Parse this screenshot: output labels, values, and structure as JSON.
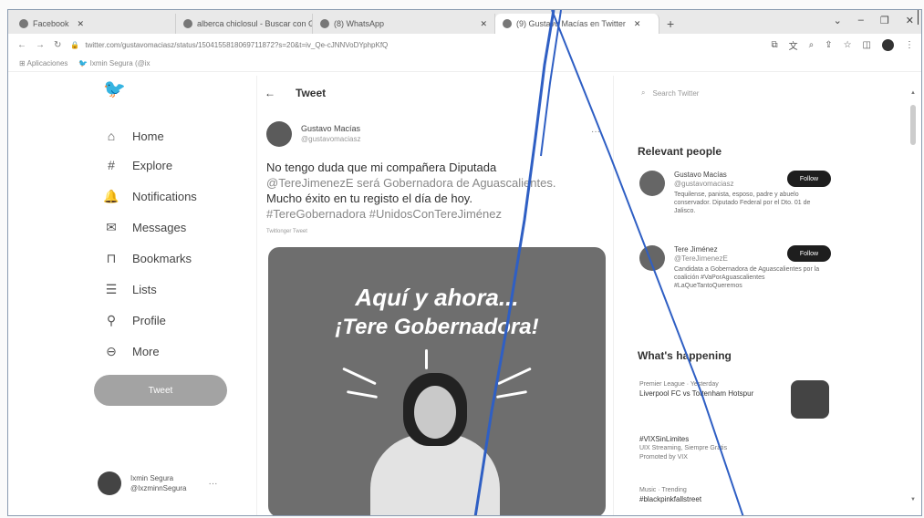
{
  "browser": {
    "tabs": [
      {
        "label": "Facebook",
        "active": false
      },
      {
        "label": "alberca chiclosul - Buscar con G",
        "active": false
      },
      {
        "label": "(8) WhatsApp",
        "active": false
      },
      {
        "label": "(9) Gustavo Macías en Twitter",
        "active": true
      }
    ],
    "url": "twitter.com/gustavomaciasz/status/1504155818069711872?s=20&t=iv_Qe-cJNNVoDYphpKfQ",
    "bookmarks": [
      "Aplicaciones",
      "Ixmin Segura (@ix"
    ]
  },
  "nav": {
    "items": [
      "Home",
      "Explore",
      "Notifications",
      "Messages",
      "Bookmarks",
      "Lists",
      "Profile",
      "More"
    ],
    "tweet_button": "Tweet",
    "account_name": "Ixmin Segura",
    "account_handle": "@IxzminnSegura"
  },
  "main": {
    "header": "Tweet",
    "author_name": "Gustavo Macías",
    "author_handle": "@gustavomaciasz",
    "text_line1": "No tengo duda que mi compañera Diputada",
    "text_line2": "@TereJimenezE será Gobernadora de Aguascalientes.",
    "text_line3": "Mucho éxito en tu registo el día de hoy.",
    "text_line4": "#TereGobernadora #UnidosConTereJiménez",
    "source": "Twitlonger Tweet",
    "image_line1": "Aquí y ahora...",
    "image_line2": "¡Tere Gobernadora!"
  },
  "sidebar": {
    "search_placeholder": "Search Twitter",
    "relevant_title": "Relevant people",
    "people": [
      {
        "name": "Gustavo Macías",
        "handle": "@gustavomaciasz",
        "bio": "Tequilense, panista, esposo, padre y abuelo conservador. Diputado Federal por el Dto. 01 de Jalisco.",
        "button": "Follow"
      },
      {
        "name": "Tere Jiménez",
        "handle": "@TereJimenezE",
        "bio": "Candidata a Gobernadora de Aguascalientes por la coalición #VaPorAguascalientes #LaQueTantoQueremos",
        "button": "Follow"
      }
    ],
    "happening_title": "What's happening",
    "trends": [
      {
        "meta": "Premier League · Yesterday",
        "title": "Liverpool FC vs Tottenham Hotspur"
      },
      {
        "meta": "UIX Streaming, Siempre Gratis",
        "title": "#VIXSinLimites",
        "promo": "Promoted by VIX"
      },
      {
        "meta": "Music · Trending",
        "title": "#blackpinkfallstreet"
      }
    ]
  },
  "colors": {
    "frame": "#8a9bb0",
    "pen": "#2f5fc4",
    "media": "#6e6e6e"
  }
}
